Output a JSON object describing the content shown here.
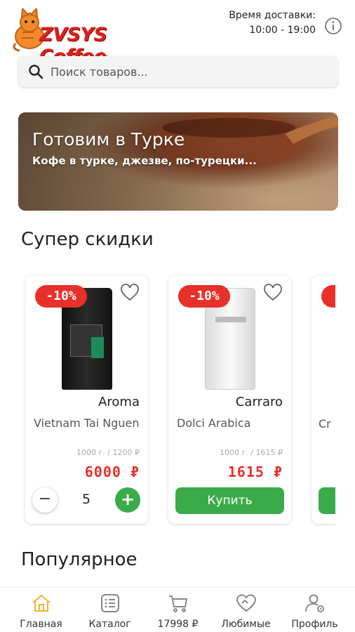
{
  "header": {
    "logo_text": "ZVSYS Coffee",
    "delivery_label": "Время доставки:",
    "delivery_hours": "10:00 - 19:00"
  },
  "search": {
    "placeholder": "Поиск товаров..."
  },
  "banner": {
    "title": "Готовим в Турке",
    "subtitle": "Кофе в турке, джезве, по-турецки..."
  },
  "sections": {
    "discounts_title": "Супер скидки",
    "popular_title": "Популярное"
  },
  "products": [
    {
      "discount": "-10%",
      "brand": "Aroma",
      "name": "Vietnam Tai Nguen",
      "pack": "1000 г. / 1200 ₽",
      "price": "6000 ₽",
      "quantity": "5",
      "minus": "−",
      "plus": "+"
    },
    {
      "discount": "-10%",
      "brand": "Carraro",
      "name": "Dolci Arabica",
      "pack": "1000 г. / 1615 ₽",
      "price": "1615 ₽",
      "buy_label": "Купить"
    },
    {
      "name": "Cr"
    }
  ],
  "nav": [
    {
      "label": "Главная",
      "icon": "home-icon",
      "active": true
    },
    {
      "label": "Каталог",
      "icon": "catalog-icon"
    },
    {
      "label": "17998 ₽",
      "icon": "cart-icon"
    },
    {
      "label": "Любимые",
      "icon": "favorites-icon"
    },
    {
      "label": "Профиль",
      "icon": "profile-icon"
    }
  ],
  "colors": {
    "brand_red": "#e8302a",
    "accent_green": "#3bab4a",
    "nav_active": "#f2b233"
  }
}
